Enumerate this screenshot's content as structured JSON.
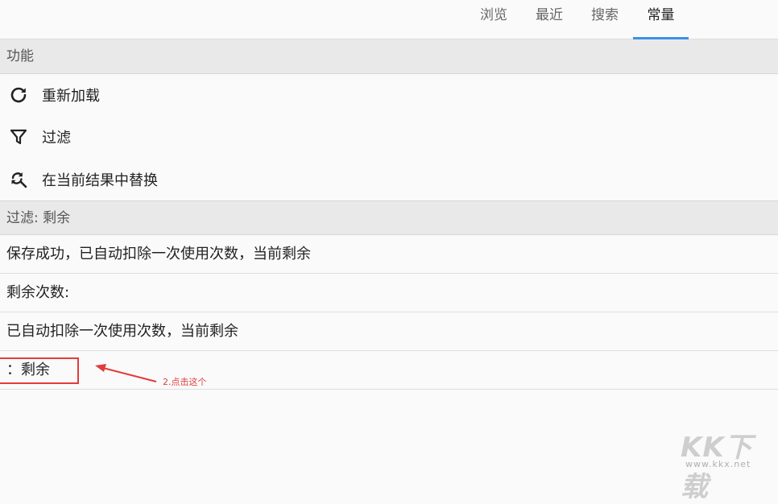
{
  "tabs": [
    {
      "label": "浏览",
      "active": false
    },
    {
      "label": "最近",
      "active": false
    },
    {
      "label": "搜索",
      "active": false
    },
    {
      "label": "常量",
      "active": true
    }
  ],
  "sections": {
    "functions": "功能",
    "filter": "过滤: 剩余"
  },
  "actions": [
    {
      "label": "重新加载",
      "icon": "reload-icon"
    },
    {
      "label": "过滤",
      "icon": "filter-icon"
    },
    {
      "label": "在当前结果中替换",
      "icon": "search-replace-icon"
    }
  ],
  "results": [
    "保存成功，已自动扣除一次使用次数，当前剩余",
    "剩余次数:",
    "已自动扣除一次使用次数，当前剩余",
    "：剩余"
  ],
  "annotation": {
    "text": "2.点击这个",
    "color": "#e33b3b"
  },
  "watermark": {
    "letters": "KK下载",
    "url": "www.kkx.net"
  },
  "accent_color": "#3c91e6"
}
